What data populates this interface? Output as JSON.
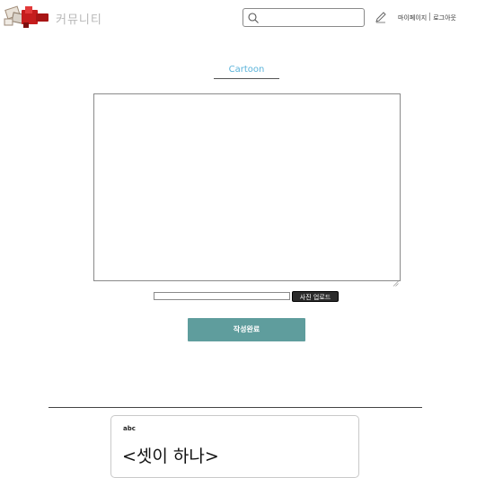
{
  "header": {
    "logo_alt": "logo",
    "brand": "커뮤니티",
    "search": {
      "placeholder": "",
      "value": ""
    },
    "links": {
      "mypage": "마이페이지",
      "logout": "로그아웃"
    }
  },
  "form": {
    "category": "Cartoon",
    "content_value": "",
    "file_path_value": "",
    "upload_label": "사진 업로드",
    "submit_label": "작성완료"
  },
  "posts": [
    {
      "author": "abc",
      "title": "<셋이 하나>"
    }
  ],
  "colors": {
    "category_accent": "#5bb3da",
    "submit_bg": "#5f9d9d",
    "upload_bg": "#2b2b2b",
    "brand_text": "#b7b7b7"
  },
  "icons": {
    "search": "search-icon",
    "write": "pencil-icon",
    "resize": "resize-grip-icon"
  }
}
